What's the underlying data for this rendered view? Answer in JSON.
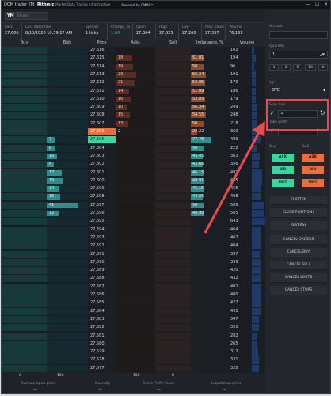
{
  "window": {
    "title": "DOM trader YM",
    "brand": "Rithmic",
    "brand_sub": "Market Data Trading Infrastructure",
    "powered": "Powered by OMNE™",
    "btn_min": "—",
    "btn_max": "☐",
    "btn_close": "✕"
  },
  "symbol": {
    "value": "YM",
    "placeholder": "Rithmic"
  },
  "stats": [
    {
      "label": "Last",
      "value": "27,606"
    },
    {
      "label": "Last date/time",
      "value": "8/10/2020 10:39:27 AM"
    },
    {
      "label": "Spread",
      "value": "1 ticks"
    },
    {
      "label": "Change, %",
      "value": "1.00"
    },
    {
      "label": "Open",
      "value": "27,364"
    },
    {
      "label": "High",
      "value": "27,625"
    },
    {
      "label": "Low",
      "value": "27,260"
    },
    {
      "label": "Prev. close",
      "value": "27,337"
    },
    {
      "label": "Volume",
      "value": "76,169"
    }
  ],
  "columns": {
    "buy": "Buy",
    "bids": "Bids",
    "price": "Price",
    "asks": "Asks",
    "sell": "Sell",
    "imbalance": "Imbalance, %",
    "volume": "Volume"
  },
  "rows": [
    {
      "price": "27,616",
      "ask": "",
      "bid": "",
      "imb": "",
      "vol": "102"
    },
    {
      "price": "27,615",
      "ask": "18",
      "bid": "",
      "imb": "51.01",
      "vol": "194"
    },
    {
      "price": "27,614",
      "ask": "19",
      "bid": "",
      "imb": "50",
      "vol": "96"
    },
    {
      "price": "27,613",
      "ask": "23",
      "bid": "",
      "imb": "55.34",
      "vol": "191"
    },
    {
      "price": "27,612",
      "ask": "21",
      "bid": "",
      "imb": "53.85",
      "vol": "179"
    },
    {
      "price": "27,611",
      "ask": "14",
      "bid": "",
      "imb": "51.09",
      "vol": "186"
    },
    {
      "price": "27,610",
      "ask": "16",
      "bid": "",
      "imb": "53.85",
      "vol": "179"
    },
    {
      "price": "27,609",
      "ask": "10",
      "bid": "",
      "imb": "56.34",
      "vol": "249"
    },
    {
      "price": "27,608",
      "ask": "15",
      "bid": "",
      "imb": "54.55",
      "vol": "248"
    },
    {
      "price": "27,607",
      "ask": "13",
      "bid": "",
      "imb": "50",
      "vol": "218"
    },
    {
      "price": "27,606",
      "ask": "2",
      "bid": "",
      "imb": "22.22",
      "vol": "360"
    },
    {
      "price": "27,605",
      "ask": "",
      "bid": "7",
      "imb": "77.78",
      "vol": "409"
    },
    {
      "price": "27,604",
      "ask": "",
      "bid": "8",
      "imb": "50",
      "vol": "222"
    },
    {
      "price": "27,603",
      "ask": "",
      "bid": "10",
      "imb": "45.45",
      "vol": "383"
    },
    {
      "price": "27,602",
      "ask": "",
      "bid": "6",
      "imb": "43.66",
      "vol": "356"
    },
    {
      "price": "27,601",
      "ask": "",
      "bid": "17",
      "imb": "46.15",
      "vol": "497"
    },
    {
      "price": "27,600",
      "ask": "",
      "bid": "19",
      "imb": "48.91",
      "vol": "495"
    },
    {
      "price": "27,599",
      "ask": "",
      "bid": "14",
      "imb": "46.15",
      "vol": "455"
    },
    {
      "price": "27,598",
      "ask": "",
      "bid": "15",
      "imb": "44.66",
      "vol": "408"
    },
    {
      "price": "27,597",
      "ask": "",
      "bid": "41",
      "imb": "50",
      "vol": "589"
    },
    {
      "price": "27,596",
      "ask": "",
      "bid": "12",
      "imb": "48.99",
      "vol": "565"
    },
    {
      "price": "27,595",
      "ask": "",
      "bid": "",
      "imb": "",
      "vol": "643"
    },
    {
      "price": "27,594",
      "ask": "",
      "bid": "",
      "imb": "",
      "vol": "464"
    },
    {
      "price": "27,593",
      "ask": "",
      "bid": "",
      "imb": "",
      "vol": "462"
    },
    {
      "price": "27,592",
      "ask": "",
      "bid": "",
      "imb": "",
      "vol": "404"
    },
    {
      "price": "27,591",
      "ask": "",
      "bid": "",
      "imb": "",
      "vol": "397"
    },
    {
      "price": "27,590",
      "ask": "",
      "bid": "",
      "imb": "",
      "vol": "399"
    },
    {
      "price": "27,589",
      "ask": "",
      "bid": "",
      "imb": "",
      "vol": "420"
    },
    {
      "price": "27,588",
      "ask": "",
      "bid": "",
      "imb": "",
      "vol": "432"
    },
    {
      "price": "27,587",
      "ask": "",
      "bid": "",
      "imb": "",
      "vol": "402"
    },
    {
      "price": "27,586",
      "ask": "",
      "bid": "",
      "imb": "",
      "vol": "400"
    },
    {
      "price": "27,585",
      "ask": "",
      "bid": "",
      "imb": "",
      "vol": "422"
    },
    {
      "price": "27,584",
      "ask": "",
      "bid": "",
      "imb": "",
      "vol": "431"
    },
    {
      "price": "27,583",
      "ask": "",
      "bid": "",
      "imb": "",
      "vol": "347"
    },
    {
      "price": "27,582",
      "ask": "",
      "bid": "",
      "imb": "",
      "vol": "331"
    },
    {
      "price": "27,581",
      "ask": "",
      "bid": "",
      "imb": "",
      "vol": "282"
    },
    {
      "price": "27,580",
      "ask": "",
      "bid": "",
      "imb": "",
      "vol": "265"
    },
    {
      "price": "27,579",
      "ask": "",
      "bid": "",
      "imb": "",
      "vol": "312"
    },
    {
      "price": "27,578",
      "ask": "",
      "bid": "",
      "imb": "",
      "vol": "331"
    },
    {
      "price": "27,577",
      "ask": "",
      "bid": "",
      "imb": "",
      "vol": "328"
    }
  ],
  "footer": {
    "buy_total": "0",
    "bids_total": "150",
    "asks_total": "166",
    "sell_total": "0",
    "avg_label": "Average open price",
    "avg_value": "---",
    "qty_label": "Quantity",
    "qty_value": "---",
    "pl_label": "Gross Profit / Loss",
    "pl_value": "---",
    "liq_label": "Liquidation price",
    "liq_value": "---"
  },
  "panel": {
    "account_label": "Account",
    "account_value": "",
    "quantity_label": "Quantity",
    "quantity_value": "1",
    "qty_buttons": [
      "1",
      "2",
      "5",
      "10",
      "X"
    ],
    "tif_label": "TIF",
    "tif_value": "GTC",
    "stop_label": "Stop loss",
    "stop_value": "4",
    "take_label": "Take profit",
    "take_value": "4",
    "buy_label": "Buy",
    "sell_label": "Sell",
    "ask": "ASK",
    "bid": "BID",
    "mkt": "MKT",
    "actions": [
      "FLATTEN",
      "CLOSE POSITIONS",
      "REVERSE"
    ],
    "cancels": [
      "CANCEL ORDERS",
      "CANCEL BUY",
      "CANCEL SELL",
      "CANCEL LIMITS",
      "CANCEL STOPS"
    ]
  },
  "colors": {
    "accent_ask": "#ec6c3a",
    "accent_bid": "#3ad6a0",
    "highlight": "#e84b4f"
  }
}
